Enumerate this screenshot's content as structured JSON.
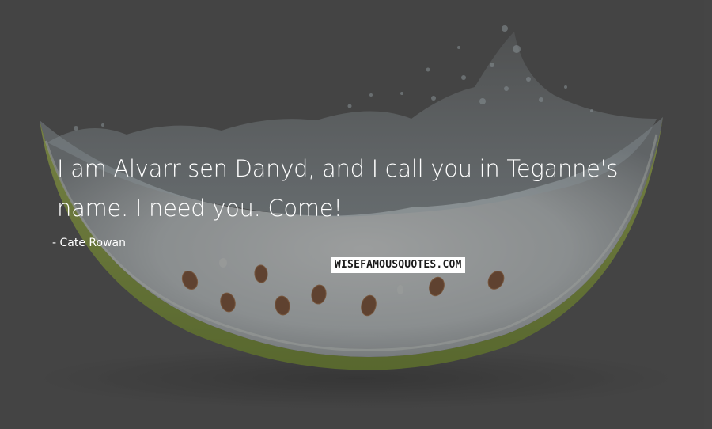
{
  "quote": {
    "line1": "I am Alvarr sen Danyd, and I call you in Teganne's",
    "line2": "name. I need you. Come!"
  },
  "author": "- Cate Rowan",
  "brand": "WISEFAMOUSQUOTES.COM",
  "background": {
    "image": "watermelon-slice-splash",
    "base_color": "#4a4a4a",
    "rind_color": "#7f9a2e",
    "flesh_color": "#dde2e2",
    "seed_color": "#7a4526"
  }
}
